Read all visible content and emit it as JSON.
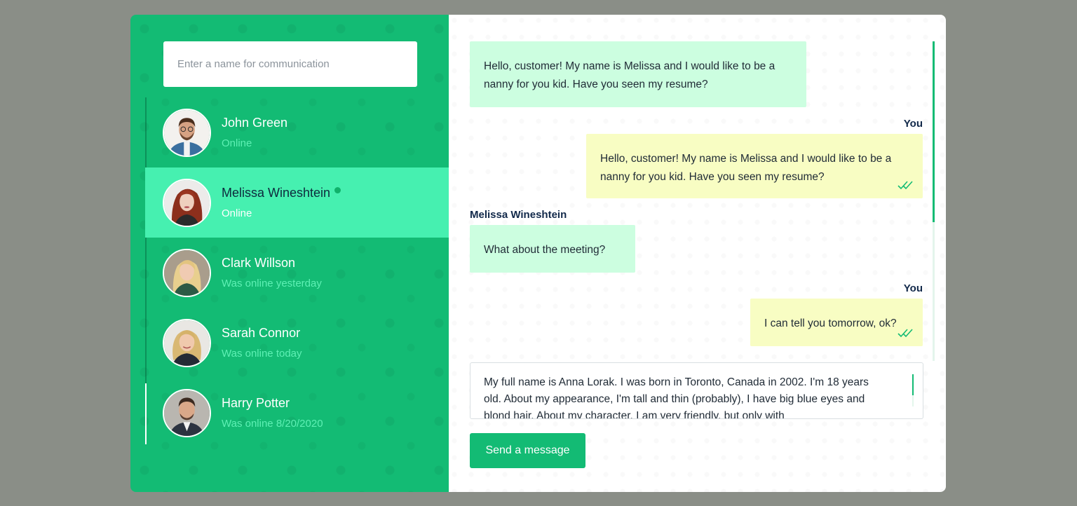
{
  "search": {
    "placeholder": "Enter a name for communication"
  },
  "contacts": [
    {
      "name": "John Green",
      "status": "Online",
      "active": false
    },
    {
      "name": "Melissa Wineshtein",
      "status": "Online",
      "active": true
    },
    {
      "name": "Clark Willson",
      "status": "Was online yesterday",
      "active": false
    },
    {
      "name": "Sarah Connor",
      "status": "Was online today",
      "active": false
    },
    {
      "name": "Harry Potter",
      "status": "Was online 8/20/2020",
      "active": false
    }
  ],
  "messages": [
    {
      "direction": "in",
      "text": "Hello, customer! My name is Melissa and I would like to be a nanny for you kid. Have you seen my resume?"
    },
    {
      "direction": "out",
      "sender": "You",
      "text": "Hello, customer! My name is Melissa and I would like to be a nanny for you kid. Have you seen my resume?",
      "read_icon": "double-check-icon"
    },
    {
      "direction": "in",
      "sender": "Melissa Wineshtein",
      "text": "What about the meeting?"
    },
    {
      "direction": "out",
      "sender": "You",
      "text": "I can tell you tomorrow, ok?",
      "read_icon": "double-check-icon"
    }
  ],
  "composer": {
    "text": "My full name is Anna Lorak. I was born in Toronto, Canada in 2002. I'm 18 years old. About my appearance, I'm tall and thin (probably), I have big blue eyes and blond hair. About my character, I am very friendly, but only with"
  },
  "send_label": "Send a message",
  "colors": {
    "brand_green": "#13bb74",
    "active_contact": "#46f0b0",
    "incoming_bubble": "#ccfee0",
    "outgoing_bubble": "#f8fdc3",
    "status_text": "#5ef0b4",
    "page_background": "#8a8e87"
  }
}
